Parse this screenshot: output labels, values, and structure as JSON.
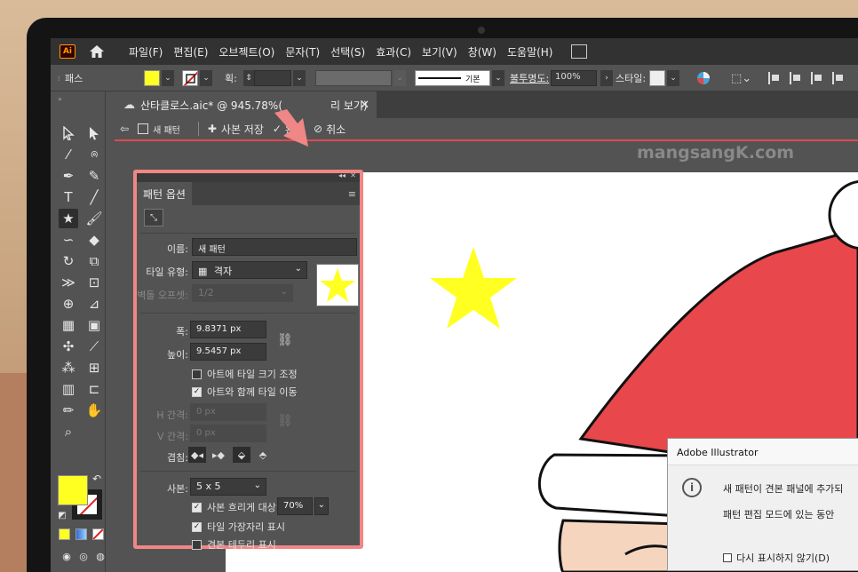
{
  "app": {
    "logo_text": "Ai",
    "menu": [
      "파일(F)",
      "편집(E)",
      "오브젝트(O)",
      "문자(T)",
      "선택(S)",
      "효과(C)",
      "보기(V)",
      "창(W)",
      "도움말(H)"
    ]
  },
  "control_bar": {
    "path_label": "패스",
    "stroke_label": "획:",
    "stroke_style": "기본",
    "opacity_label": "불투명도:",
    "opacity_value": "100%",
    "style_label": "스타일:",
    "fill_color": "#ffff22"
  },
  "document": {
    "tab_title": "산타클로스.aic* @ 945.78%(",
    "tab_suffix": "리 보기)"
  },
  "pattern_bar": {
    "mode_label": "새 패턴",
    "save_copy": "사본 저장",
    "done": "완료",
    "cancel": "취소"
  },
  "watermark": "mangsangK.com",
  "pattern_options": {
    "tab": "패턴 옵션",
    "name_label": "이름:",
    "name_value": "새 패턴",
    "tile_type_label": "타일 유형:",
    "tile_type_value": "격자",
    "brick_offset_label": "벽돌 오프셋:",
    "brick_offset_value": "1/2",
    "width_label": "폭:",
    "width_value": "9.8371 px",
    "height_label": "높이:",
    "height_value": "9.5457 px",
    "size_tile_to_art": "아트에 타일 크기 조정",
    "move_tile_with_art": "아트와 함께 타일 이동",
    "h_spacing_label": "H 간격:",
    "h_spacing_value": "0 px",
    "v_spacing_label": "V 간격:",
    "v_spacing_value": "0 px",
    "overlap_label": "겹침:",
    "copies_label": "사본:",
    "copies_value": "5 x 5",
    "dim_copies_label": "사본 흐리게 대상:",
    "dim_copies_value": "70%",
    "show_tile_edge": "타일 가장자리 표시",
    "show_swatch_bounds": "견본 테두리 표시"
  },
  "dialog": {
    "title": "Adobe Illustrator",
    "line1": "새 패턴이 견본 패널에 추가되",
    "line2": "패턴 편집 모드에 있는 동안 ",
    "dont_show": "다시 표시하지 않기(D)"
  },
  "colors": {
    "accent_red": "#e2484f",
    "highlight": "#f08686",
    "star_yellow": "#ffff22",
    "santa_red": "#e8474b"
  }
}
